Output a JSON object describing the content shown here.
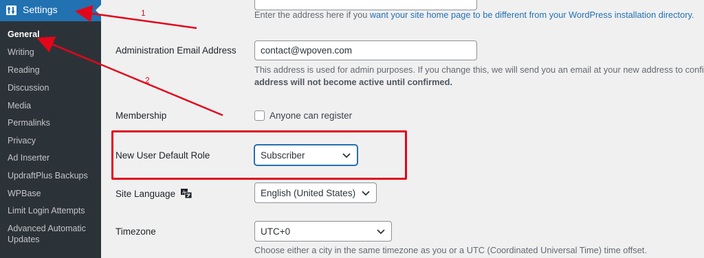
{
  "sidebar": {
    "title": "Settings",
    "items": [
      {
        "label": "General",
        "current": true
      },
      {
        "label": "Writing"
      },
      {
        "label": "Reading"
      },
      {
        "label": "Discussion"
      },
      {
        "label": "Media"
      },
      {
        "label": "Permalinks"
      },
      {
        "label": "Privacy"
      },
      {
        "label": "Ad Inserter"
      },
      {
        "label": "UpdraftPlus Backups"
      },
      {
        "label": "WPBase"
      },
      {
        "label": "Limit Login Attempts"
      },
      {
        "label": "Advanced Automatic Updates"
      }
    ]
  },
  "site_address": {
    "desc_prefix": "Enter the address here if you ",
    "desc_link": "want your site home page to be different from your WordPress installation directory."
  },
  "admin_email": {
    "label": "Administration Email Address",
    "value": "contact@wpoven.com",
    "desc_line1": "This address is used for admin purposes. If you change this, we will send you an email at your new address to confi",
    "desc_line2": "address will not become active until confirmed."
  },
  "membership": {
    "label": "Membership",
    "checkbox_label": "Anyone can register",
    "checked": false
  },
  "default_role": {
    "label": "New User Default Role",
    "value": "Subscriber"
  },
  "site_language": {
    "label": "Site Language",
    "value": "English (United States)"
  },
  "timezone": {
    "label": "Timezone",
    "value": "UTC+0",
    "desc": "Choose either a city in the same timezone as you or a UTC (Coordinated Universal Time) time offset."
  },
  "annotations": {
    "arrow1_label": "1",
    "arrow2_label": "2",
    "color": "#e3061a"
  },
  "colors": {
    "accent": "#2271b1",
    "sidebar_bg": "#1d2327",
    "submenu_bg": "#2c3338"
  }
}
